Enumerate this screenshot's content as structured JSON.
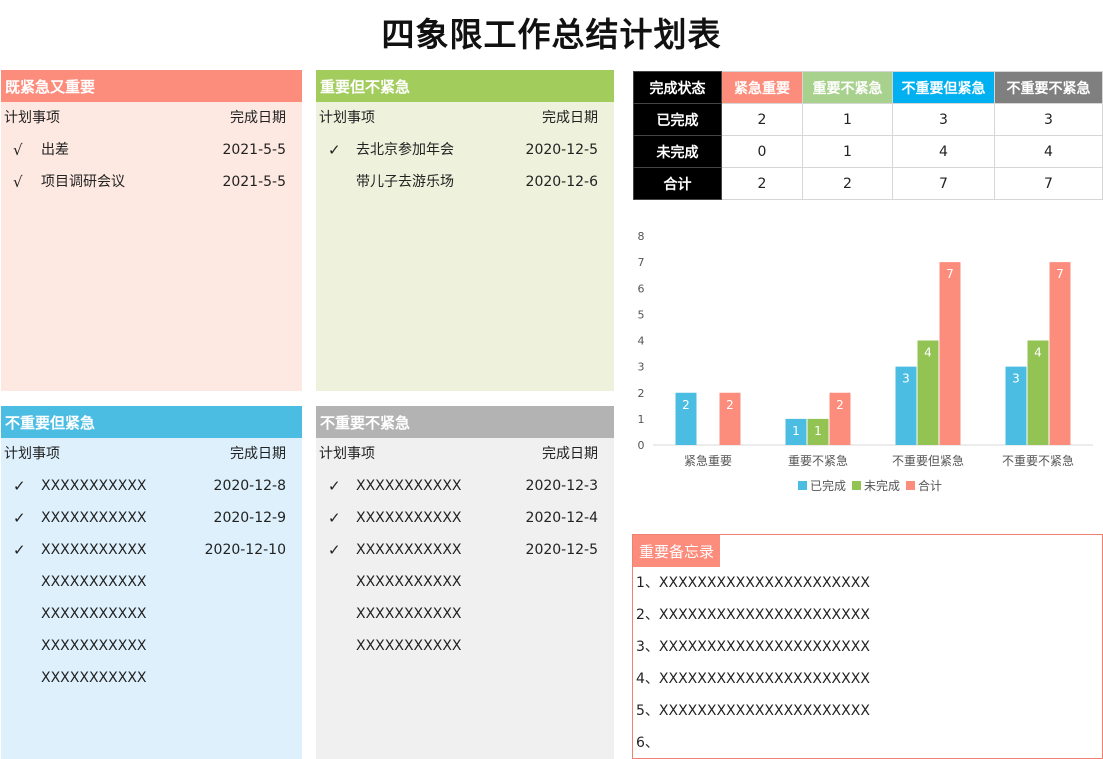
{
  "title": "四象限工作总结计划表",
  "quadrants": [
    {
      "id": "q1",
      "title": "既紧急又重要",
      "col_item": "计划事项",
      "col_date": "完成日期",
      "rows": [
        {
          "check": "√",
          "item": "出差",
          "date": "2021-5-5"
        },
        {
          "check": "√",
          "item": "项目调研会议",
          "date": "2021-5-5"
        }
      ]
    },
    {
      "id": "q2",
      "title": "重要但不紧急",
      "col_item": "计划事项",
      "col_date": "完成日期",
      "rows": [
        {
          "check": "✓",
          "item": "去北京参加年会",
          "date": "2020-12-5"
        },
        {
          "check": "",
          "item": "带儿子去游乐场",
          "date": "2020-12-6"
        }
      ]
    },
    {
      "id": "q3",
      "title": "不重要但紧急",
      "col_item": "计划事项",
      "col_date": "完成日期",
      "rows": [
        {
          "check": "✓",
          "item": "XXXXXXXXXXX",
          "date": "2020-12-8"
        },
        {
          "check": "✓",
          "item": "XXXXXXXXXXX",
          "date": "2020-12-9"
        },
        {
          "check": "✓",
          "item": "XXXXXXXXXXX",
          "date": "2020-12-10"
        },
        {
          "check": "",
          "item": "XXXXXXXXXXX",
          "date": ""
        },
        {
          "check": "",
          "item": "XXXXXXXXXXX",
          "date": ""
        },
        {
          "check": "",
          "item": "XXXXXXXXXXX",
          "date": ""
        },
        {
          "check": "",
          "item": "XXXXXXXXXXX",
          "date": ""
        }
      ]
    },
    {
      "id": "q4",
      "title": "不重要不紧急",
      "col_item": "计划事项",
      "col_date": "完成日期",
      "rows": [
        {
          "check": "✓",
          "item": "XXXXXXXXXXX",
          "date": "2020-12-3"
        },
        {
          "check": "✓",
          "item": "XXXXXXXXXXX",
          "date": "2020-12-4"
        },
        {
          "check": "✓",
          "item": "XXXXXXXXXXX",
          "date": "2020-12-5"
        },
        {
          "check": "",
          "item": "XXXXXXXXXXX",
          "date": ""
        },
        {
          "check": "",
          "item": "XXXXXXXXXXX",
          "date": ""
        },
        {
          "check": "",
          "item": "XXXXXXXXXXX",
          "date": ""
        }
      ]
    }
  ],
  "status_table": {
    "corner": "完成状态",
    "columns": [
      {
        "label": "紧急重要",
        "color": "#fc8c7c"
      },
      {
        "label": "重要不紧急",
        "color": "#a9d18e"
      },
      {
        "label": "不重要但紧急",
        "color": "#00b0f0"
      },
      {
        "label": "不重要不紧急",
        "color": "#7f7f7f"
      }
    ],
    "rows": [
      {
        "label": "已完成",
        "values": [
          "2",
          "1",
          "3",
          "3"
        ]
      },
      {
        "label": "未完成",
        "values": [
          "0",
          "1",
          "4",
          "4"
        ]
      },
      {
        "label": "合计",
        "values": [
          "2",
          "2",
          "7",
          "7"
        ]
      }
    ]
  },
  "chart_data": {
    "type": "bar",
    "categories": [
      "紧急重要",
      "重要不紧急",
      "不重要但紧急",
      "不重要不紧急"
    ],
    "series": [
      {
        "name": "已完成",
        "values": [
          2,
          1,
          3,
          3
        ],
        "color": "#4cbde2"
      },
      {
        "name": "未完成",
        "values": [
          0,
          1,
          4,
          4
        ],
        "color": "#92c353"
      },
      {
        "name": "合计",
        "values": [
          2,
          2,
          7,
          7
        ],
        "color": "#fc8c7c"
      }
    ],
    "ylim": [
      0,
      8
    ],
    "yticks": [
      0,
      1,
      2,
      3,
      4,
      5,
      6,
      7,
      8
    ],
    "grid": false,
    "legend": "bottom",
    "data_labels": true
  },
  "memo": {
    "title": "重要备忘录",
    "lines": [
      "1、XXXXXXXXXXXXXXXXXXXXXX",
      "2、XXXXXXXXXXXXXXXXXXXXXX",
      "3、XXXXXXXXXXXXXXXXXXXXXX",
      "4、XXXXXXXXXXXXXXXXXXXXXX",
      "5、XXXXXXXXXXXXXXXXXXXXXX",
      "6、"
    ]
  }
}
